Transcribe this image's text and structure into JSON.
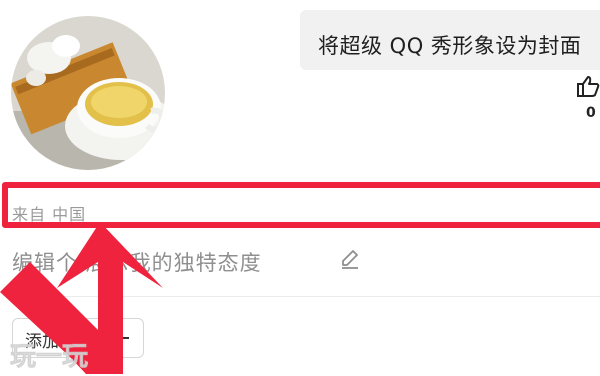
{
  "profile": {
    "cover_banner_text": "将超级 QQ 秀形象设为封面",
    "like_count": "0",
    "location": "来自 中国",
    "bio_placeholder": "编辑个   展示我的独特态度",
    "add_tag_label": "添加标签"
  },
  "annotation": {
    "color": "#f0233e",
    "highlight": "location"
  },
  "watermark_text": "玩一玩",
  "icons": [
    "thumbs-up-icon",
    "pencil-icon",
    "plus-icon",
    "red-arrow-annotation"
  ]
}
